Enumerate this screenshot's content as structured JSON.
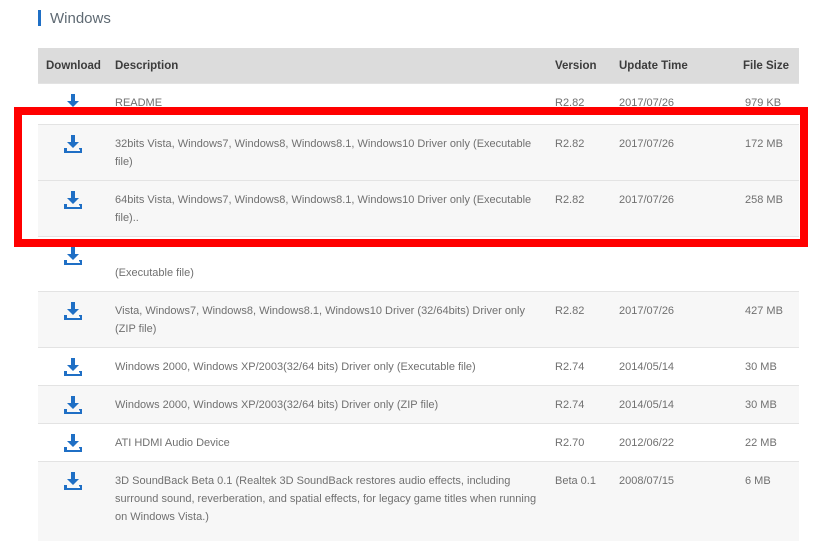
{
  "section": {
    "title": "Windows"
  },
  "colors": {
    "accent": "#1f6fc5",
    "highlight": "#ff0000",
    "header_bg": "#dcdcdc"
  },
  "table": {
    "headers": {
      "download": "Download",
      "description": "Description",
      "version": "Version",
      "update_time": "Update Time",
      "file_size": "File Size"
    },
    "rows": [
      {
        "description": "README",
        "version": "R2.82",
        "date": "2017/07/26",
        "size": "979 KB"
      },
      {
        "description": "32bits Vista, Windows7, Windows8, Windows8.1, Windows10 Driver only (Executable file)",
        "version": "R2.82",
        "date": "2017/07/26",
        "size": "172 MB"
      },
      {
        "description": "64bits Vista, Windows7, Windows8, Windows8.1, Windows10 Driver only (Executable file)..",
        "version": "R2.82",
        "date": "2017/07/26",
        "size": "258 MB"
      },
      {
        "description": "(Executable file)",
        "version": "",
        "date": "",
        "size": ""
      },
      {
        "description": "Vista, Windows7, Windows8, Windows8.1, Windows10 Driver (32/64bits) Driver only (ZIP file)",
        "version": "R2.82",
        "date": "2017/07/26",
        "size": "427 MB"
      },
      {
        "description": "Windows 2000, Windows XP/2003(32/64 bits) Driver only (Executable file)",
        "version": "R2.74",
        "date": "2014/05/14",
        "size": "30 MB"
      },
      {
        "description": "Windows 2000, Windows XP/2003(32/64 bits) Driver only (ZIP file)",
        "version": "R2.74",
        "date": "2014/05/14",
        "size": "30 MB"
      },
      {
        "description": "ATI HDMI Audio Device",
        "version": "R2.70",
        "date": "2012/06/22",
        "size": "22 MB"
      },
      {
        "description": "3D SoundBack Beta 0.1 (Realtek 3D SoundBack restores audio effects, including surround sound, reverberation, and spatial effects, for legacy game titles when running on Windows Vista.)",
        "version": "Beta 0.1",
        "date": "2008/07/15",
        "size": "6 MB"
      }
    ]
  }
}
